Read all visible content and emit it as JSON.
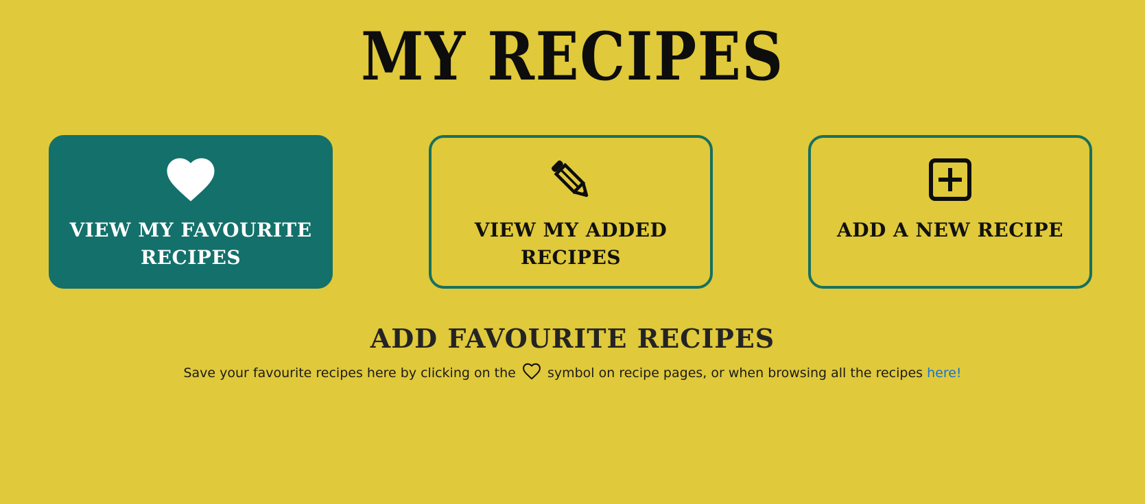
{
  "page": {
    "title": "MY RECIPES",
    "background_color": "#e0c93a",
    "accent_color": "#14706a"
  },
  "cards": [
    {
      "label": "VIEW MY FAVOURITE RECIPES",
      "icon": "heart-icon",
      "active": true
    },
    {
      "label": "VIEW MY ADDED RECIPES",
      "icon": "pencil-icon",
      "active": false
    },
    {
      "label": "ADD A NEW RECIPE",
      "icon": "plus-square-icon",
      "active": false
    }
  ],
  "section": {
    "heading": "ADD FAVOURITE RECIPES",
    "text_before": "Save your favourite recipes here by clicking on the",
    "inline_icon": "heart-outline-icon",
    "text_after": "symbol on recipe pages, or when browsing all the recipes",
    "link_text": "here!",
    "link_color": "#1573d6"
  }
}
